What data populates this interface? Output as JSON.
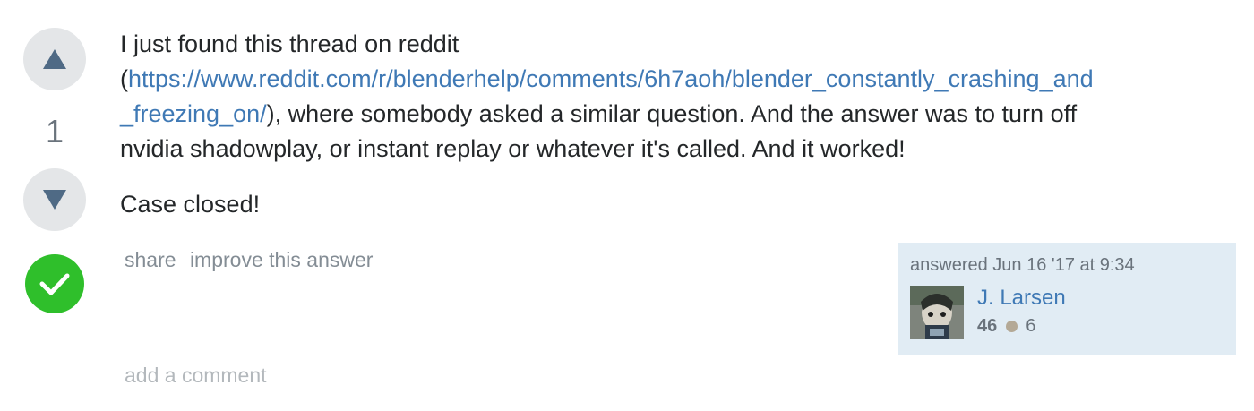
{
  "votes": {
    "up_icon": "triangle-up-icon",
    "down_icon": "triangle-down-icon",
    "count": "1",
    "accepted_icon": "checkmark-icon",
    "accepted_color": "#2fbf2b"
  },
  "post": {
    "line1": "I just found this thread on reddit",
    "paren_open": "(",
    "link_text": "https://www.reddit.com/r/blenderhelp/comments/6h7aoh/blender_constantly_crashing_and_freezing_on/",
    "after_link": "), where somebody asked a similar question. And the answer was to turn off nvidia shadowplay, or instant replay or whatever it's called. And it worked!",
    "paragraph2": "Case closed!"
  },
  "menu": {
    "share": "share",
    "improve": "improve this answer"
  },
  "user_card": {
    "action": "answered Jun 16 '17 at 9:34",
    "name": "J. Larsen",
    "reputation": "46",
    "bronze_badges": "6",
    "background": "#e1ecf4"
  },
  "comments": {
    "add_comment": "add a comment"
  },
  "colors": {
    "link": "#3f79b5",
    "text": "#242729",
    "muted": "#848d95"
  }
}
